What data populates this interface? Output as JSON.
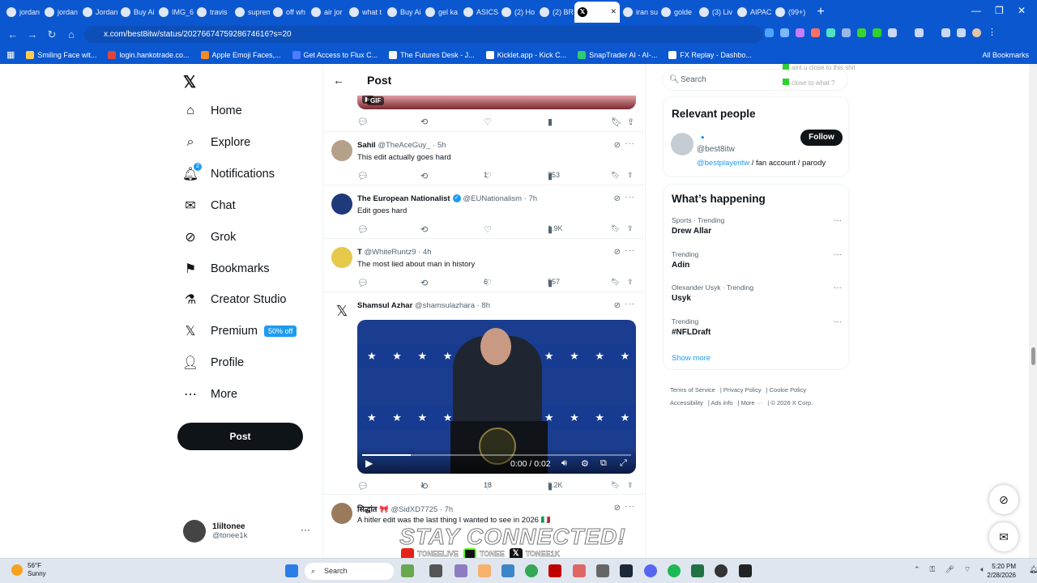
{
  "browser": {
    "tabs": [
      "jordan",
      "jordan",
      "Jordan",
      "Buy Ai",
      "IMG_6",
      "travis",
      "suprem",
      "off wh",
      "air jor",
      "what t",
      "Buy Ai",
      "gel ka",
      "ASICS",
      "(2) Ho",
      "(2) BR",
      "",
      "iran su",
      "golde",
      "(3) Liv",
      "AIPAC",
      "(99+)"
    ],
    "url": "x.com/best8itw/status/2027667475928674616?s=20",
    "bookmarks": [
      "Smiling Face wit...",
      "login.hankotrade.co...",
      "Apple Emoji Faces,...",
      "Get Access to Flux C...",
      "The Futures Desk - J...",
      "Kicklet.app - Kick C...",
      "SnapTrader AI - AI-...",
      "FX Replay - Dashbo..."
    ],
    "all_bookmarks": "All Bookmarks"
  },
  "sidebar": {
    "items": [
      {
        "label": "Home",
        "icon": "home-icon"
      },
      {
        "label": "Explore",
        "icon": "search-icon"
      },
      {
        "label": "Notifications",
        "icon": "bell-icon",
        "badge": "2"
      },
      {
        "label": "Chat",
        "icon": "mail-icon"
      },
      {
        "label": "Grok",
        "icon": "grok-icon"
      },
      {
        "label": "Bookmarks",
        "icon": "bookmark-icon"
      },
      {
        "label": "Creator Studio",
        "icon": "creator-icon"
      },
      {
        "label": "Premium",
        "icon": "x-logo-icon",
        "badge": "50% off"
      },
      {
        "label": "Profile",
        "icon": "user-icon"
      },
      {
        "label": "More",
        "icon": "more-circle-icon"
      }
    ],
    "post_label": "Post",
    "account": {
      "name": "1liltonee",
      "handle": "@tonee1k"
    }
  },
  "feed": {
    "header_title": "Post",
    "gif_label": "GIF",
    "tweets": [
      {
        "name": "Sahil",
        "handle": "@TheAceGuy_ · 5h",
        "text": "This edit actually goes hard",
        "replies": "",
        "reposts": "",
        "likes": "1",
        "views": "753"
      },
      {
        "name": "The European Nationalist",
        "handle": "@EUNationalism · 7h",
        "text": "Edit goes hard",
        "replies": "",
        "reposts": "",
        "likes": "",
        "views": "1.9K"
      },
      {
        "name": "T",
        "handle": "@WhiteRuntz9 · 4h",
        "text": "The most lied about man in history",
        "replies": "",
        "reposts": "",
        "likes": "6",
        "views": "557"
      },
      {
        "name": "Shamsul Azhar",
        "handle": "@shamsulazhara · 8h",
        "text": "",
        "replies": "",
        "reposts": "1",
        "likes": "18",
        "views": "3.2K"
      },
      {
        "name": "सिद्धांत 🎀",
        "handle": "@SidXD7725 · 7h",
        "text": "A hitler edit was the last thing I wanted to see in 2026 🇮🇹",
        "replies": "",
        "reposts": "",
        "likes": "",
        "views": ""
      }
    ],
    "video": {
      "time": "0:00 / 0:02",
      "progress": 0.18
    }
  },
  "right": {
    "search_placeholder": "Search",
    "relevant_title": "Relevant people",
    "person": {
      "handle": "@best8itw",
      "bio_link": "@bestplayeritw",
      "bio_rest": " / fan account / parody",
      "follow_label": "Follow"
    },
    "happening_title": "What’s happening",
    "trends": [
      {
        "category": "Sports · Trending",
        "name": "Drew Allar"
      },
      {
        "category": "Trending",
        "name": "Adin"
      },
      {
        "category": "Olexander Usyk · Trending",
        "name": "Usyk"
      },
      {
        "category": "Trending",
        "name": "#NFLDraft"
      }
    ],
    "show_more": "Show more",
    "footer": [
      "Terms of Service",
      "Privacy Policy",
      "Cookie Policy",
      "Accessibility",
      "Ads info",
      "More ···",
      "© 2026 X Corp."
    ]
  },
  "overlay": {
    "stay_connected": "STAY CONNECTED!",
    "socials": [
      "TONEELIVE",
      "TONEE",
      "TONEE1K"
    ],
    "chat": [
      "aint u close to this shit",
      "close to what ?"
    ]
  },
  "taskbar": {
    "temp": "56°F",
    "weather": "Sunny",
    "weather_badge": "1",
    "search": "Search",
    "time": "5:20 PM",
    "date": "2/28/2026"
  }
}
